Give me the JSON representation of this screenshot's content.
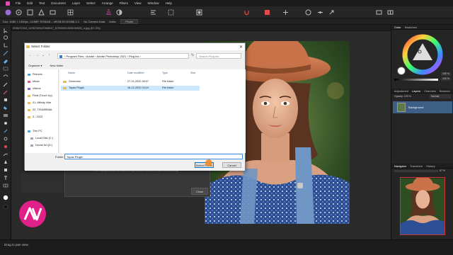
{
  "menubar": {
    "items": [
      "File",
      "Edit",
      "Text",
      "Document",
      "Layer",
      "Select",
      "Arrange",
      "Filters",
      "View",
      "Window",
      "Help"
    ]
  },
  "context": {
    "dimensions": "Doc: 1080 × 1350px, 144MP, RGBA/8 – sRGB IEC61966-2.1",
    "camera": "No Camera Data",
    "units_label": "Units:",
    "units_value": "Pixels"
  },
  "doc_tab": "305672315_1196749547068047_87900001523230928_n.jpg (57.3%)",
  "behind_dialog": {
    "message": "We Changes made to these settings will take effect when you restart Affinity.",
    "close_label": "Close"
  },
  "dialog": {
    "title": "Select Folder",
    "breadcrumb": "‹ Program Files  ›  Adobe  ›  Adobe Photoshop 2021  ›  Plug-ins  ›",
    "search_placeholder": "Search Plug-ins",
    "organize_label": "Organize ▾",
    "new_folder_label": "New folder",
    "columns": [
      "Name",
      "Date modified",
      "Type",
      "Size"
    ],
    "nav_items": [
      {
        "label": "Pictures",
        "color": "#4aa3df"
      },
      {
        "label": "Music",
        "color": "#e0587a"
      },
      {
        "label": "Videos",
        "color": "#8b5fd0"
      },
      {
        "label": "Final (Touch Up)",
        "color": "#e8b94b"
      },
      {
        "label": "01- Affinity Vide",
        "color": "#e8b94b"
      },
      {
        "label": "02- THUMBNAIL",
        "color": "#e8b94b"
      },
      {
        "label": "3 - 2023",
        "color": "#e8b94b"
      },
      {
        "label": "This PC",
        "color": "#4aa3df"
      },
      {
        "label": "Local Disk (C:)",
        "color": "#9aa7b4"
      },
      {
        "label": "Decrei Art (D:)",
        "color": "#9aa7b4"
      }
    ],
    "files": [
      {
        "name": "Generator",
        "date": "27-01-2022 06:07",
        "type": "File folder",
        "selected": false
      },
      {
        "name": "Topaz Plugin",
        "date": "16-12-2022 04:19",
        "type": "File folder",
        "selected": true
      }
    ],
    "folder_label": "Folder:",
    "folder_value": "Topaz Plugin",
    "select_button": "Select Folder",
    "cancel_button": "Cancel"
  },
  "right_panel": {
    "color_tabs": [
      "Color",
      "Swatches"
    ],
    "opacity": "100 %",
    "opacity2": "100 %",
    "layer_tabs": [
      "Adjustment",
      "Layers",
      "Channels",
      "Brushes"
    ],
    "layer_opacity": "Opacity: 100 %",
    "blend_mode": "Normal",
    "layer_name": "Background",
    "nav_tabs": [
      "Navigator",
      "Transform",
      "History"
    ],
    "zoom": "57 %"
  },
  "statusbar": {
    "text": "Drag to pan view."
  }
}
